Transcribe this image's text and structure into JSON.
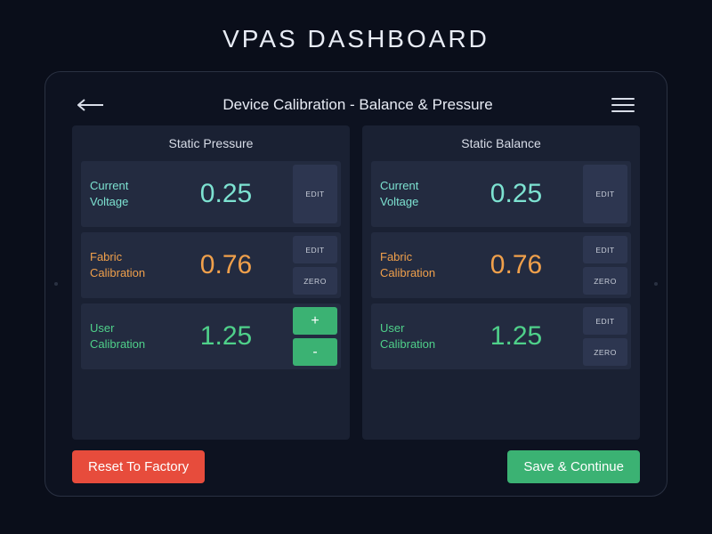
{
  "page_title": "VPAS DASHBOARD",
  "screen_title": "Device Calibration - Balance & Pressure",
  "panels": {
    "pressure": {
      "title": "Static Pressure",
      "rows": {
        "voltage": {
          "label": "Current Voltage",
          "value": "0.25",
          "actions": [
            "EDIT"
          ]
        },
        "fabric": {
          "label": "Fabric Calibration",
          "value": "0.76",
          "actions": [
            "EDIT",
            "ZERO"
          ]
        },
        "user": {
          "label": "User Calibration",
          "value": "1.25",
          "stepper": {
            "plus": "+",
            "minus": "-"
          }
        }
      }
    },
    "balance": {
      "title": "Static Balance",
      "rows": {
        "voltage": {
          "label": "Current Voltage",
          "value": "0.25",
          "actions": [
            "EDIT"
          ]
        },
        "fabric": {
          "label": "Fabric Calibration",
          "value": "0.76",
          "actions": [
            "EDIT",
            "ZERO"
          ]
        },
        "user": {
          "label": "User Calibration",
          "value": "1.25",
          "actions": [
            "EDIT",
            "ZERO"
          ]
        }
      }
    }
  },
  "footer": {
    "reset": "Reset To Factory",
    "save": "Save & Continue"
  },
  "colors": {
    "teal": "#7de2d1",
    "orange": "#f0a04b",
    "green": "#4fd08a",
    "danger": "#e74c3c",
    "success": "#3bb273",
    "panel_bg": "#1a2133",
    "row_bg": "#232b40"
  }
}
